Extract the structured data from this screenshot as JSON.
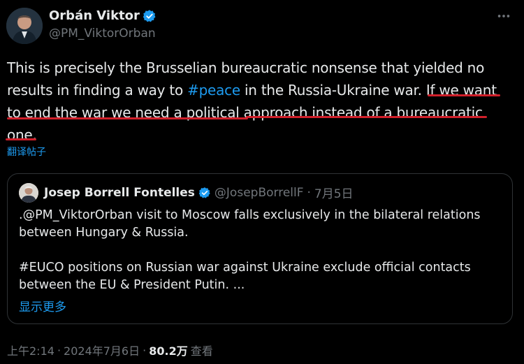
{
  "author": {
    "name": "Orbán Viktor",
    "handle": "@PM_ViktorOrban"
  },
  "tweet": {
    "line1": "This is precisely the Brusselian bureaucratic nonsense that yielded no",
    "line2_before": "results in finding a way to ",
    "line2_hashtag": "#peace",
    "line2_after": " in the Russia-Ukraine war. If we want",
    "line3": "to end the war we need a political approach instead of a bureaucratic",
    "line4": "one.",
    "translate_label": "翻译帖子"
  },
  "quote": {
    "name": "Josep Borrell Fontelles",
    "handle": "@JosepBorrellF",
    "separator": "·",
    "date": "7月5日",
    "line1": ".@PM_ViktorOrban visit to Moscow falls exclusively in the bilateral relations",
    "line2": "between Hungary & Russia.",
    "line3": "",
    "line4": "#EUCO positions on Russian war against Ukraine exclude official contacts",
    "line5": "between the EU & President Putin. ...",
    "show_more": "显示更多"
  },
  "meta": {
    "time": "上午2:14",
    "sep1": "·",
    "date": "2024年7月6日",
    "sep2": "·",
    "views": "80.2万",
    "views_label": "查看"
  },
  "colors": {
    "background": "#000000",
    "text": "#e7e9ea",
    "muted": "#71767b",
    "link": "#1d9bf0",
    "verified": "#1d9bf0",
    "annotation_underline": "#d11f2a",
    "border": "#2f3336"
  },
  "icons": {
    "verified": "verified-badge-icon",
    "more": "more-options-icon"
  }
}
